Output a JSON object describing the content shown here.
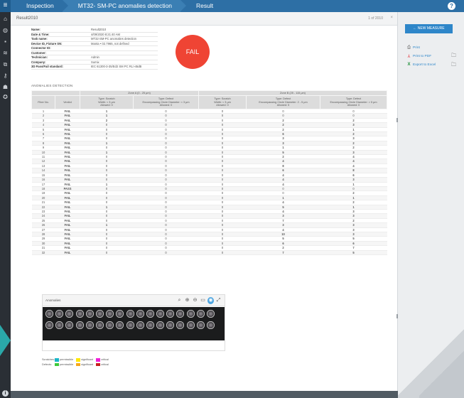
{
  "header": {
    "breadcrumbs": [
      "Inspection",
      "MT32- SM-PC anomalies detection",
      "Result"
    ],
    "help_icon": "help-circle-icon"
  },
  "sidebar": {
    "icons": [
      "menu-icon",
      "home-icon",
      "globe-icon",
      "chat-icon",
      "chart-icon",
      "copy-icon",
      "key-icon",
      "users-icon",
      "settings-icon",
      "info-icon"
    ]
  },
  "panel": {
    "title": "Result2010",
    "pager": "1 of 2010",
    "close": "×"
  },
  "info": [
    {
      "label": "Name:",
      "value": "Result2010"
    },
    {
      "label": "Date & Time:",
      "value": "4/09/2020 8:21:40 AM"
    },
    {
      "label": "Task name:",
      "value": "MT32-SM-PC anomalies detection"
    },
    {
      "label": "Device ID, Fixture SN:",
      "value": "Manta • 02.7965, not defined"
    },
    {
      "label": "Connector ID:",
      "value": ""
    },
    {
      "label": "Customer:",
      "value": ""
    },
    {
      "label": "Technician:",
      "value": "Admin"
    },
    {
      "label": "Company:",
      "value": "Sumix"
    },
    {
      "label": "3D Pass/Fail standard:",
      "value": "IEC 61300-3-35/Ed2 SM PC RL>45dB"
    }
  ],
  "verdict": "FAIL",
  "section_title": "ANOMALIES DETECTION",
  "table": {
    "zone_a": "Zone A (0 - 25 μm)",
    "zone_b": "Zone B (25 - 115 μm)",
    "headers": [
      "Fiber No.",
      "Verdict",
      "Type: Scratch\nWidth: < 3 μm\nAllowed: 0",
      "Type: Defect\nEncompassing Circle Diameter: < 3 μm\nAllowed: 0",
      "Type: Scratch\nWidth: < 3 μm\nAllowed: 0",
      "Type: Defect\nEncompassing Circle Diameter: 2 - 5 μm\nAllowed: 5",
      "Type: Defect\nEncompassing Circle Diameter: > 5 μm\nAllowed: 0"
    ],
    "rows": [
      [
        "1",
        "FAIL",
        "1",
        "0",
        "0",
        "0",
        "0"
      ],
      [
        "2",
        "FAIL",
        "1",
        "0",
        "0",
        "0",
        "0"
      ],
      [
        "3",
        "FAIL",
        "2",
        "0",
        "0",
        "2",
        "2"
      ],
      [
        "4",
        "FAIL",
        "0",
        "0",
        "0",
        "2",
        "3"
      ],
      [
        "5",
        "FAIL",
        "0",
        "0",
        "0",
        "2",
        "1"
      ],
      [
        "6",
        "FAIL",
        "0",
        "0",
        "0",
        "6",
        "2"
      ],
      [
        "7",
        "FAIL",
        "0",
        "0",
        "0",
        "3",
        "3"
      ],
      [
        "8",
        "FAIL",
        "1",
        "0",
        "0",
        "3",
        "2"
      ],
      [
        "9",
        "FAIL",
        "0",
        "0",
        "0",
        "1",
        "2"
      ],
      [
        "10",
        "FAIL",
        "1",
        "0",
        "0",
        "5",
        "3"
      ],
      [
        "11",
        "FAIL",
        "0",
        "0",
        "0",
        "2",
        "4"
      ],
      [
        "12",
        "FAIL",
        "0",
        "0",
        "0",
        "4",
        "4"
      ],
      [
        "13",
        "FAIL",
        "0",
        "0",
        "0",
        "8",
        "4"
      ],
      [
        "14",
        "FAIL",
        "0",
        "0",
        "0",
        "6",
        "8"
      ],
      [
        "15",
        "FAIL",
        "0",
        "0",
        "0",
        "4",
        "6"
      ],
      [
        "16",
        "FAIL",
        "0",
        "0",
        "0",
        "4",
        "3"
      ],
      [
        "17",
        "FAIL",
        "1",
        "0",
        "0",
        "4",
        "1"
      ],
      [
        "18",
        "PASS",
        "0",
        "0",
        "0",
        "0",
        "0"
      ],
      [
        "19",
        "FAIL",
        "0",
        "0",
        "0",
        "0",
        "2"
      ],
      [
        "20",
        "FAIL",
        "0",
        "0",
        "0",
        "1",
        "1"
      ],
      [
        "21",
        "FAIL",
        "0",
        "0",
        "0",
        "4",
        "2"
      ],
      [
        "22",
        "FAIL",
        "1",
        "0",
        "0",
        "5",
        "1"
      ],
      [
        "23",
        "FAIL",
        "0",
        "0",
        "0",
        "4",
        "3"
      ],
      [
        "24",
        "FAIL",
        "0",
        "0",
        "0",
        "3",
        "3"
      ],
      [
        "25",
        "FAIL",
        "0",
        "0",
        "0",
        "7",
        "2"
      ],
      [
        "26",
        "FAIL",
        "1",
        "0",
        "0",
        "3",
        "3"
      ],
      [
        "27",
        "FAIL",
        "0",
        "0",
        "0",
        "4",
        "3"
      ],
      [
        "28",
        "FAIL",
        "0",
        "0",
        "0",
        "10",
        "3"
      ],
      [
        "29",
        "FAIL",
        "0",
        "0",
        "0",
        "5",
        "5"
      ],
      [
        "30",
        "FAIL",
        "0",
        "0",
        "0",
        "6",
        "6"
      ],
      [
        "31",
        "FAIL",
        "0",
        "0",
        "0",
        "2",
        "7"
      ],
      [
        "32",
        "FAIL",
        "0",
        "0",
        "0",
        "7",
        "5"
      ]
    ]
  },
  "anomalies": {
    "title": "Anomalies",
    "tools": [
      "search-icon",
      "zoom-in-icon",
      "zoom-out-icon",
      "fit-icon",
      "highlight-icon",
      "expand-icon"
    ],
    "fiber_count": 34
  },
  "legend": {
    "scratches_label": "Scratches:",
    "defects_label": "Defects:",
    "scratches": [
      {
        "color": "#19b6c8",
        "label": "permissible"
      },
      {
        "color": "#ffe800",
        "label": "significant"
      },
      {
        "color": "#f01ed8",
        "label": "critical"
      }
    ],
    "defects": [
      {
        "color": "#3ec93a",
        "label": "permissible"
      },
      {
        "color": "#f7a81a",
        "label": "significant"
      },
      {
        "color": "#c8201e",
        "label": "critical"
      }
    ]
  },
  "right": {
    "new_measure": "← NEW MEASURE",
    "print": "Print",
    "print_pdf": "Print to PDF",
    "export_excel": "Export to Excel"
  },
  "colors": {
    "accent": "#2e86c9",
    "fail": "#e8262e",
    "pass": "#20b2c6"
  }
}
